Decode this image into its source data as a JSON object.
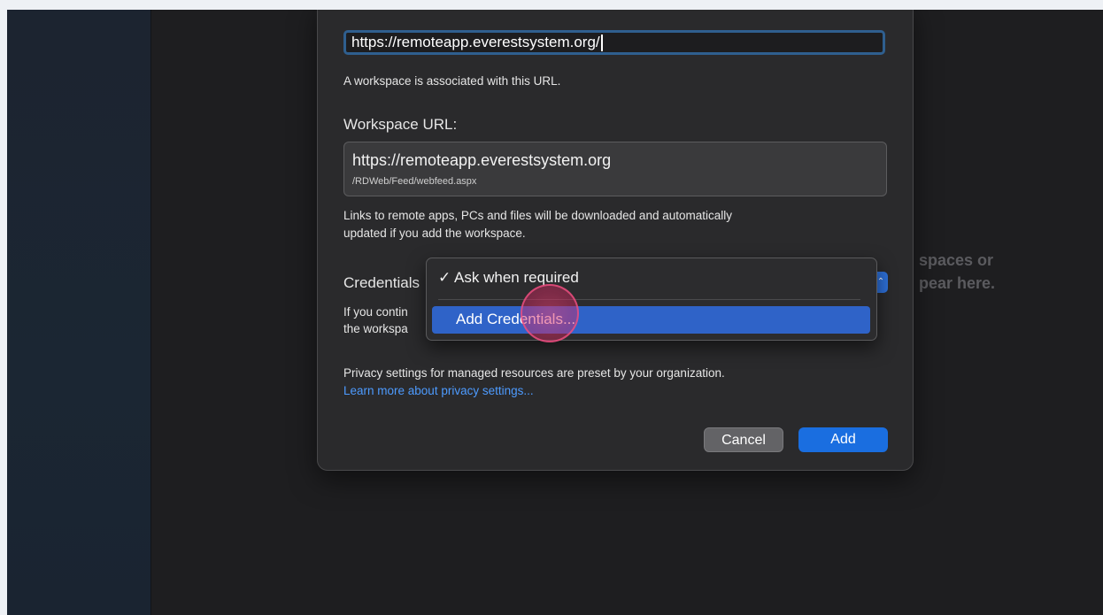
{
  "background": {
    "empty_line1": "spaces or",
    "empty_line2": "pear here."
  },
  "dialog": {
    "url_input_value": "https://remoteapp.everestsystem.org/",
    "url_note": "A workspace is associated with this URL.",
    "workspace_url_label": "Workspace URL:",
    "workspace_url_main": "https://remoteapp.everestsystem.org",
    "workspace_url_sub": "/RDWeb/Feed/webfeed.aspx",
    "links_note_line1": "Links to remote apps, PCs and files will be downloaded and automatically",
    "links_note_line2": "updated if you add the workspace.",
    "credentials_label": "Credentials",
    "credentials_note_line1": "If you contin",
    "credentials_note_line2": "the workspa",
    "privacy_note": "Privacy settings for managed resources are preset by your organization.",
    "privacy_link": "Learn more about privacy settings...",
    "cancel_label": "Cancel",
    "add_label": "Add"
  },
  "credentials_menu": {
    "checked_item": "✓ Ask when required",
    "highlighted_item": "Add Credentials..."
  },
  "colors": {
    "accent": "#1a6ee0",
    "highlight": "#2f63c8",
    "link": "#4d9bff",
    "click_indicator": "#e63c6e"
  }
}
